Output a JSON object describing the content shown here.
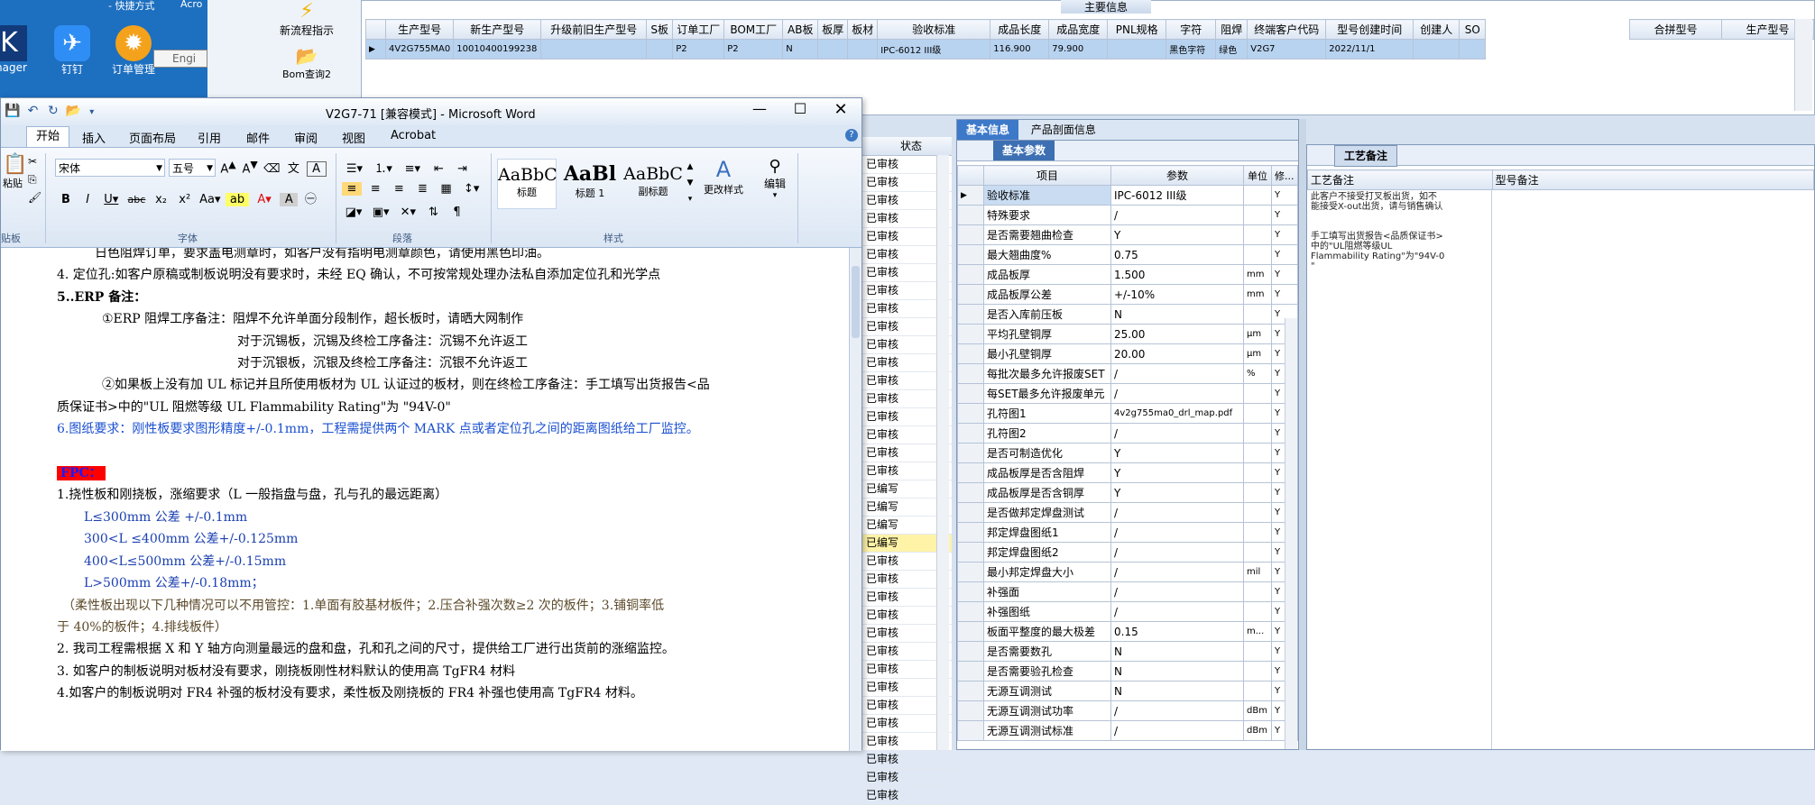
{
  "desktop": {
    "top_fragment": "- 快捷方式",
    "top_fragment2": "Acro",
    "icons": [
      {
        "label": "nager",
        "icon": "k-app-icon"
      },
      {
        "label": "钉钉",
        "icon": "dingtalk-icon"
      },
      {
        "label": "订单管理",
        "icon": "order-mgmt-icon"
      }
    ],
    "engine_label": "Engi"
  },
  "erp_toolbar": {
    "new_flow": "新流程指示",
    "bom_query": "Bom查询2"
  },
  "main_info": {
    "title": "主要信息",
    "columns": [
      "生产型号",
      "新生产型号",
      "升级前旧生产型号",
      "S板",
      "订单工厂",
      "BOM工厂",
      "AB板",
      "板厚",
      "板材",
      "验收标准",
      "成品长度",
      "成品宽度",
      "PNL规格",
      "字符",
      "阻焊",
      "终端客户代码",
      "型号创建时间",
      "创建人",
      "SO"
    ],
    "row": [
      "4V2G755MA0",
      "10010400199238",
      "",
      "",
      "P2",
      "P2",
      "N",
      "",
      "",
      "IPC-6012 III级",
      "116.900",
      "79.900",
      "",
      "黑色字符",
      "绿色",
      "V2G7",
      "2022/11/1",
      "",
      ""
    ],
    "right_cols": [
      "合拼型号",
      "生产型号"
    ]
  },
  "word": {
    "title": "V2G7-71 [兼容模式] - Microsoft Word",
    "tabs": [
      "开始",
      "插入",
      "页面布局",
      "引用",
      "邮件",
      "审阅",
      "视图",
      "Acrobat"
    ],
    "font_name": "宋体",
    "font_size": "五号",
    "styles": [
      {
        "preview": "AaBbC",
        "name": "标题"
      },
      {
        "preview": "AaBl",
        "name": "标题 1"
      },
      {
        "preview": "AaBbC",
        "name": "副标题"
      }
    ],
    "change_style": "更改样式",
    "edit": "编辑",
    "groups": [
      "字体",
      "段落",
      "样式"
    ],
    "clipboard": "贴板",
    "paste": "粘贴",
    "lines": [
      "日色阻焊订单，要求盖电测章时，如客户没有指明电测章颜色，请使用黑色印油。",
      "4.  定位孔:如客户原稿或制板说明没有要求时，未经 EQ 确认，不可按常规处理办法私自添加定位孔和光学点",
      "5..ERP 备注：",
      "①ERP 阻焊工序备注：阻焊不允许单面分段制作，超长板时，请晒大网制作",
      "对于沉锡板，沉锡及终检工序备注：沉锡不允许返工",
      "对于沉银板，沉银及终检工序备注：沉银不允许返工",
      "②如果板上没有加 UL 标记并且所使用板材为 UL 认证过的板材，则在终检工序备注：手工填写出货报告<品",
      "质保证书>中的\"UL 阻燃等级 UL Flammability Rating\"为 \"94V-0\"",
      "6.图纸要求：刚性板要求图形精度+/-0.1mm，工程需提供两个 MARK 点或者定位孔之间的距离图纸给工厂监控。",
      "FPC：",
      "1.挠性板和刚挠板，涨缩要求（L 一般指盘与盘，孔与孔的最远距离）",
      "L≤300mm 公差 +/-0.1mm",
      "300<L ≤400mm 公差+/-0.125mm",
      "400<L≤500mm 公差+/-0.15mm",
      "L>500mm 公差+/-0.18mm；",
      "（柔性板出现以下几种情况可以不用管控：1.单面有胶基材板件；2.压合补强次数≥2  次的板件；3.铺铜率低",
      "于 40%的板件；4.排线板件）",
      "2.    我司工程需根据 X 和 Y 轴方向测量最远的盘和盘，孔和孔之间的尺寸，提供给工厂进行出货前的涨缩监控。",
      "3. 如客户的制板说明对板材没有要求，刚挠板刚性材料默认的使用高 TgFR4 材料",
      " 4.如客户的制板说明对 FR4 补强的板材没有要求，柔性板及刚挠板的 FR4 补强也使用高 TgFR4 材料。"
    ]
  },
  "status_column": {
    "header": "状态",
    "values": [
      "已审核",
      "已审核",
      "已审核",
      "已审核",
      "已审核",
      "已审核",
      "已审核",
      "已审核",
      "已审核",
      "已审核",
      "已审核",
      "已审核",
      "已审核",
      "已审核",
      "已审核",
      "已审核",
      "已审核",
      "已审核",
      "已编写",
      "已编写",
      "已编写",
      "已编写",
      "已审核",
      "已审核",
      "已审核",
      "已审核",
      "已审核",
      "已审核",
      "已审核",
      "已审核",
      "已审核",
      "已审核",
      "已审核",
      "已审核",
      "已审核",
      "已审核"
    ],
    "highlight_index": 21
  },
  "params_panel": {
    "tabs": [
      "基本信息",
      "产品剖面信息"
    ],
    "sub_tab": "基本参数",
    "headers": [
      "项目",
      "参数",
      "单位",
      "修..."
    ],
    "rows": [
      [
        "验收标准",
        "IPC-6012 III级",
        "",
        "Y"
      ],
      [
        "特殊要求",
        "/",
        "",
        "Y"
      ],
      [
        "是否需要翘曲检查",
        "Y",
        "",
        "Y"
      ],
      [
        "最大翘曲度%",
        "0.75",
        "",
        "Y"
      ],
      [
        "成品板厚",
        "1.500",
        "mm",
        "Y"
      ],
      [
        "成品板厚公差",
        "+/-10%",
        "mm",
        "Y"
      ],
      [
        "是否入库前压板",
        "N",
        "",
        "Y"
      ],
      [
        "平均孔壁铜厚",
        "25.00",
        "μm",
        "Y"
      ],
      [
        "最小孔壁铜厚",
        "20.00",
        "μm",
        "Y"
      ],
      [
        "每批次最多允许报废SET",
        "/",
        "%",
        "Y"
      ],
      [
        "每SET最多允许报废单元",
        "/",
        "",
        "Y"
      ],
      [
        "孔符图1",
        "4v2g755ma0_drl_map.pdf",
        "",
        "Y"
      ],
      [
        "孔符图2",
        "/",
        "",
        "Y"
      ],
      [
        "是否可制造优化",
        "Y",
        "",
        "Y"
      ],
      [
        "成品板厚是否含阻焊",
        "Y",
        "",
        "Y"
      ],
      [
        "成品板厚是否含铜厚",
        "Y",
        "",
        "Y"
      ],
      [
        "是否做邦定焊盘测试",
        "/",
        "",
        "Y"
      ],
      [
        "邦定焊盘图纸1",
        "/",
        "",
        "Y"
      ],
      [
        "邦定焊盘图纸2",
        "/",
        "",
        "Y"
      ],
      [
        "最小邦定焊盘大小",
        "/",
        "mil",
        "Y"
      ],
      [
        "补强面",
        "/",
        "",
        "Y"
      ],
      [
        "补强图纸",
        "/",
        "",
        "Y"
      ],
      [
        "板面平整度的最大极差",
        "0.15",
        "m...",
        "Y"
      ],
      [
        "是否需要数孔",
        "N",
        "",
        "Y"
      ],
      [
        "是否需要验孔检查",
        "N",
        "",
        "Y"
      ],
      [
        "无源互调测试",
        "N",
        "",
        "Y"
      ],
      [
        "无源互调测试功率",
        "/",
        "dBm",
        "Y"
      ],
      [
        "无源互调测试标准",
        "/",
        "dBm",
        "Y"
      ]
    ]
  },
  "process_notes": {
    "tab": "工艺备注",
    "headers": [
      "工艺备注",
      "型号备注"
    ],
    "note1": [
      "此客户不接受打叉板出货，如不",
      "能接受X-out出货，请与销售确认"
    ],
    "note2": [
      "手工填写出货报告<品质保证书>",
      "中的\"UL阻燃等级UL",
      "Flammability Rating\"为\"94V-0",
      "\""
    ]
  }
}
